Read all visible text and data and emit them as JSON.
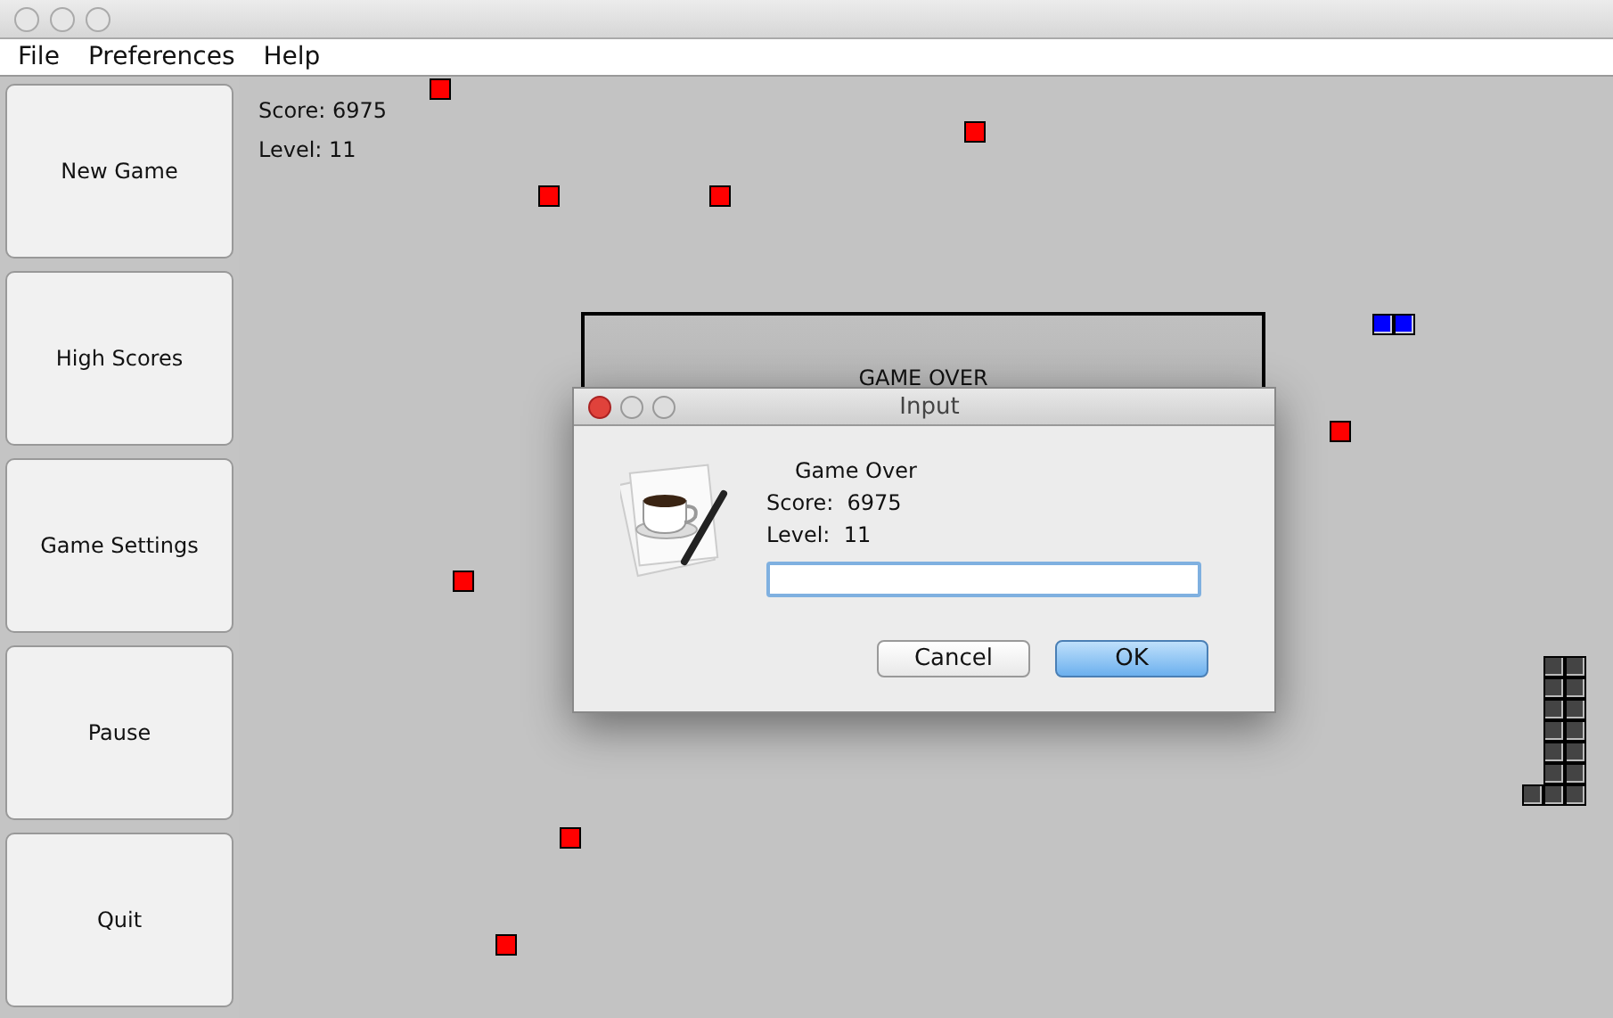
{
  "menu": [
    {
      "label": "File"
    },
    {
      "label": "Preferences"
    },
    {
      "label": "Help"
    }
  ],
  "sidebar": {
    "buttons": [
      {
        "label": "New Game"
      },
      {
        "label": "High Scores"
      },
      {
        "label": "Game Settings"
      },
      {
        "label": "Pause"
      },
      {
        "label": "Quit"
      }
    ]
  },
  "game": {
    "score": "Score: 6975",
    "level": "Level: 11",
    "banner": "GAME OVER"
  },
  "dialog": {
    "title": "Input",
    "heading": "Game Over",
    "score": "Score:  6975",
    "level": "Level:  11",
    "buttons": [
      {
        "label": "Cancel",
        "default": false
      },
      {
        "label": "OK",
        "default": true
      }
    ]
  }
}
